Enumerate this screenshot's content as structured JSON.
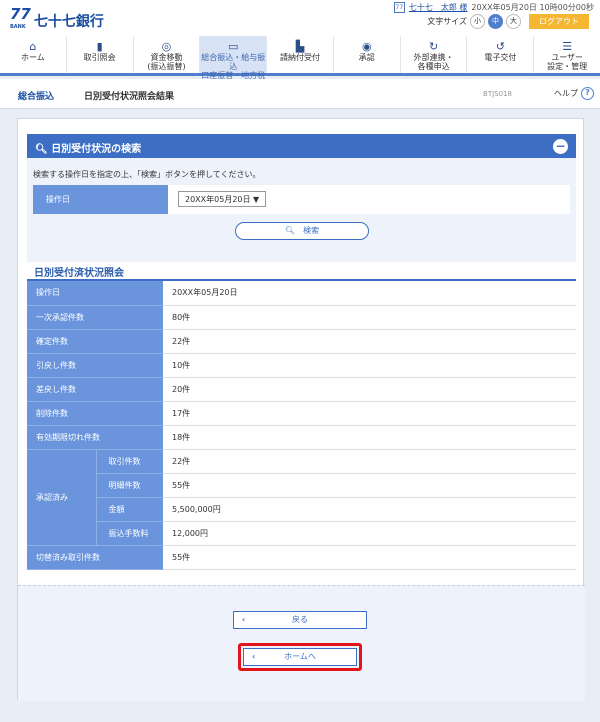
{
  "header": {
    "logo_mark": "77",
    "logo_sub": "BANK",
    "logo_text": "七十七銀行",
    "user_icon": "77",
    "user_name": "七十七　太郎 様",
    "datetime": "20XX年05月20日 10時00分00秒",
    "font_size_label": "文字サイズ",
    "font_sizes": [
      "小",
      "中",
      "大"
    ],
    "logout": "ログアウト"
  },
  "nav": {
    "items": [
      {
        "label": "ホーム",
        "icon": "home-icon"
      },
      {
        "label": "取引照会",
        "icon": "document-icon"
      },
      {
        "label": "資金移動\n(振込振替)",
        "icon": "money-transfer-icon"
      },
      {
        "label": "総合振込・給与振込\n口座振替・地方税",
        "icon": "card-icon"
      },
      {
        "label": "請納付受付",
        "icon": "payment-icon"
      },
      {
        "label": "承認",
        "icon": "approve-icon"
      },
      {
        "label": "外部連携・\n各種申込",
        "icon": "link-icon"
      },
      {
        "label": "電子交付",
        "icon": "delivery-icon"
      },
      {
        "label": "ユーザー\n設定・管理",
        "icon": "user-settings-icon"
      }
    ]
  },
  "subhead": {
    "crumb1": "総合振込",
    "crumb2": "日別受付状況照会結果",
    "screen_id": "BTJS018",
    "help": "ヘルプ",
    "help_icon": "?"
  },
  "search": {
    "title": "日別受付状況の検索",
    "description": "検索する操作日を指定の上、「検索」ボタンを押してください。",
    "date_label": "操作日",
    "date_value": "20XX年05月20日",
    "button": "検索"
  },
  "result": {
    "title": "日別受付済状況照会",
    "rows": [
      {
        "label": "操作日",
        "value": "20XX年05月20日"
      },
      {
        "label": "一次承認件数",
        "value": "80件"
      },
      {
        "label": "確定件数",
        "value": "22件"
      },
      {
        "label": "引戻し件数",
        "value": "10件"
      },
      {
        "label": "差戻し件数",
        "value": "20件"
      },
      {
        "label": "削除件数",
        "value": "17件"
      },
      {
        "label": "有効期限切れ件数",
        "value": "18件"
      }
    ],
    "approved_label": "承認済み",
    "approved_rows": [
      {
        "label": "取引件数",
        "value": "22件"
      },
      {
        "label": "明細件数",
        "value": "55件"
      },
      {
        "label": "金額",
        "value": "5,500,000円"
      },
      {
        "label": "振込手数料",
        "value": "12,000円"
      }
    ],
    "last_row": {
      "label": "切替済み取引件数",
      "value": "55件"
    }
  },
  "buttons": {
    "back": "戻る",
    "home": "ホームへ"
  }
}
